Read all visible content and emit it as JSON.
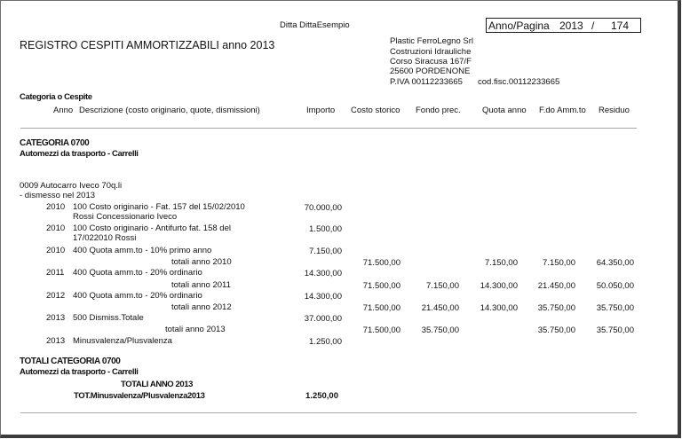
{
  "header": {
    "ditta": "Ditta DittaEsempio",
    "page_label": "Anno/Pagina",
    "year": "2013",
    "separator": "/",
    "page": "174",
    "title": "REGISTRO CESPITI AMMORTIZZABILI anno 2013",
    "company": {
      "name": "Plastic FerroLegno Srl",
      "line1": "Costruzioni Idrauliche",
      "address": "Corso Siracusa 167/F",
      "city": "25600 PORDENONE",
      "piva": "P.IVA 00112233665",
      "codfisc": "cod.fisc.00112233665"
    }
  },
  "columns": {
    "group_header": "Categoria o Cespite",
    "anno": "Anno",
    "descrizione": "Descrizione (costo originario, quote, dismissioni)",
    "importo": "Importo",
    "costo_storico": "Costo storico",
    "fondo_prec": "Fondo prec.",
    "quota_anno": "Quota anno",
    "fdo_ammto": "F.do Amm.to",
    "residuo": "Residuo"
  },
  "category": {
    "code": "CATEGORIA 0700",
    "name": "Automezzi da trasporto - Carrelli"
  },
  "asset": {
    "title": "0009 Autocarro Iveco 70q.li",
    "status": "- dismesso nel 2013"
  },
  "movements": [
    {
      "year": "2010",
      "line1": "100 Costo originario - Fat. 157 del 15/02/2010",
      "line2": "Rossi Concessionario Iveco",
      "amount": "70.000,00"
    },
    {
      "year": "2010",
      "line1": "100 Costo originario - Antifurto fat. 158 del",
      "line2": "17/022010 Rossi",
      "amount": "1.500,00"
    },
    {
      "year": "2010",
      "line1": "400 Quota amm.to - 10% primo anno",
      "amount": "7.150,00"
    },
    {
      "year": "2011",
      "line1": "400 Quota amm.to - 20% ordinario",
      "amount": "14.300,00"
    },
    {
      "year": "2012",
      "line1": "400 Quota amm.to - 20% ordinario",
      "amount": "14.300,00"
    },
    {
      "year": "2013",
      "line1": "500 Dismiss.Totale",
      "amount": "37.000,00"
    },
    {
      "year": "2013",
      "line1": "Minusvalenza/Plusvalenza",
      "amount": "1.250,00"
    }
  ],
  "totals": [
    {
      "label": "totali anno 2010",
      "costo": "71.500,00",
      "fondo": "",
      "quota": "7.150,00",
      "fdo": "7.150,00",
      "residuo": "64.350,00"
    },
    {
      "label": "totali anno 2011",
      "costo": "71.500,00",
      "fondo": "7.150,00",
      "quota": "14.300,00",
      "fdo": "21.450,00",
      "residuo": "50.050,00"
    },
    {
      "label": "totali anno 2012",
      "costo": "71.500,00",
      "fondo": "21.450,00",
      "quota": "14.300,00",
      "fdo": "35.750,00",
      "residuo": "35.750,00"
    },
    {
      "label": "totali anno 2013",
      "costo": "71.500,00",
      "fondo": "35.750,00",
      "quota": "",
      "fdo": "35.750,00",
      "residuo": "35.750,00"
    }
  ],
  "summary": {
    "title": "TOTALI CATEGORIA 0700",
    "subtitle": "Automezzi da trasporto - Carrelli",
    "year_total": "TOTALI ANNO 2013",
    "minus_label": "TOT.Minusvalenza/Plusvalenza2013",
    "minus_value": "1.250,00"
  }
}
